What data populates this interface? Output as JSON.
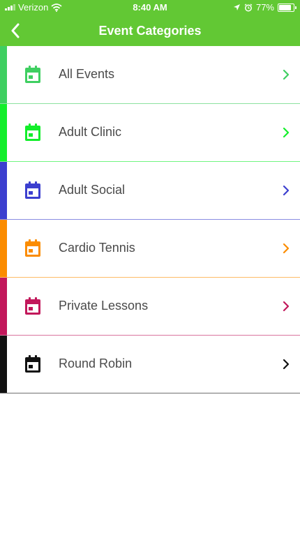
{
  "status_bar": {
    "carrier": "Verizon",
    "time": "8:40 AM",
    "battery": "77%",
    "battery_level": 0.77
  },
  "nav": {
    "title": "Event Categories",
    "back_icon": "chevron-left-icon"
  },
  "colors": {
    "bar": "#62c834"
  },
  "categories": [
    {
      "label": "All Events",
      "color": "#3fcf61",
      "icon": "calendar-icon"
    },
    {
      "label": "Adult Clinic",
      "color": "#13ee2b",
      "icon": "calendar-icon"
    },
    {
      "label": "Adult Social",
      "color": "#3c3fcf",
      "icon": "calendar-icon"
    },
    {
      "label": "Cardio Tennis",
      "color": "#fb8c00",
      "icon": "calendar-icon"
    },
    {
      "label": "Private Lessons",
      "color": "#c2185b",
      "icon": "calendar-icon"
    },
    {
      "label": "Round Robin",
      "color": "#111111",
      "icon": "calendar-icon"
    }
  ]
}
